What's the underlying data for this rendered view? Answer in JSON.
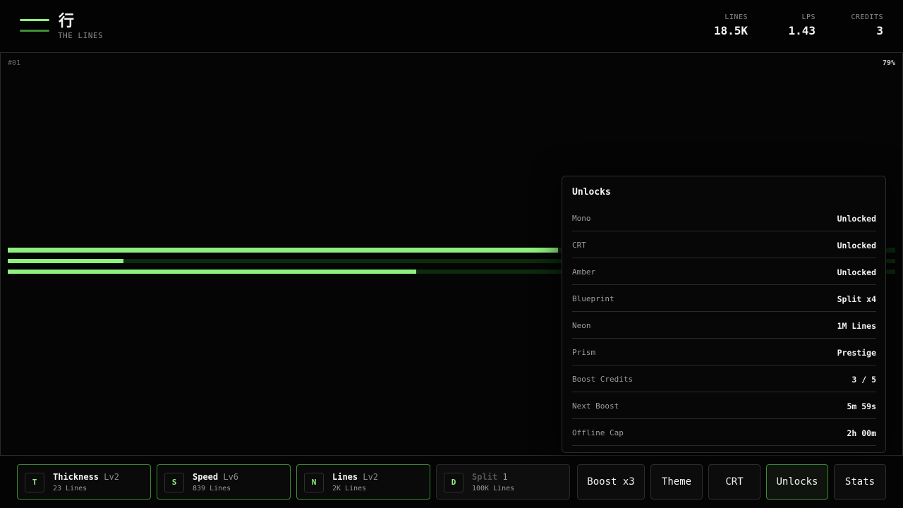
{
  "header": {
    "logo_glyph": "行",
    "logo_subtitle": "THE LINES",
    "stats": [
      {
        "label": "LINES",
        "value": "18.5K"
      },
      {
        "label": "LPS",
        "value": "1.43"
      },
      {
        "label": "CREDITS",
        "value": "3"
      }
    ]
  },
  "field": {
    "run_id": "#01",
    "progress_label": "79%",
    "tracks": [
      {
        "fill_fraction": 0.62
      },
      {
        "fill_fraction": 0.13
      },
      {
        "fill_fraction": 0.46
      }
    ]
  },
  "unlocks_panel": {
    "title": "Unlocks",
    "rows": [
      {
        "key": "Mono",
        "value": "Unlocked"
      },
      {
        "key": "CRT",
        "value": "Unlocked"
      },
      {
        "key": "Amber",
        "value": "Unlocked"
      },
      {
        "key": "Blueprint",
        "value": "Split x4"
      },
      {
        "key": "Neon",
        "value": "1M Lines"
      },
      {
        "key": "Prism",
        "value": "Prestige"
      },
      {
        "key": "Boost Credits",
        "value": "3 / 5"
      },
      {
        "key": "Next Boost",
        "value": "5m 59s"
      },
      {
        "key": "Offline Cap",
        "value": "2h 00m"
      }
    ]
  },
  "upgrades": [
    {
      "key": "T",
      "name": "Thickness",
      "level": "Lv2",
      "cost": "23 Lines"
    },
    {
      "key": "S",
      "name": "Speed",
      "level": "Lv6",
      "cost": "839 Lines"
    },
    {
      "key": "N",
      "name": "Lines",
      "level": "Lv2",
      "cost": "2K Lines"
    },
    {
      "key": "D",
      "name": "Split",
      "level": "1",
      "cost": "100K Lines"
    }
  ],
  "buttons": {
    "boost": "Boost x3",
    "theme": "Theme",
    "crt": "CRT",
    "unlocks": "Unlocks",
    "stats": "Stats"
  },
  "colors": {
    "accent": "#8ef07e",
    "accent_dark": "#3e8f38",
    "track_bg": "#0d2a0d",
    "background": "#040404"
  }
}
